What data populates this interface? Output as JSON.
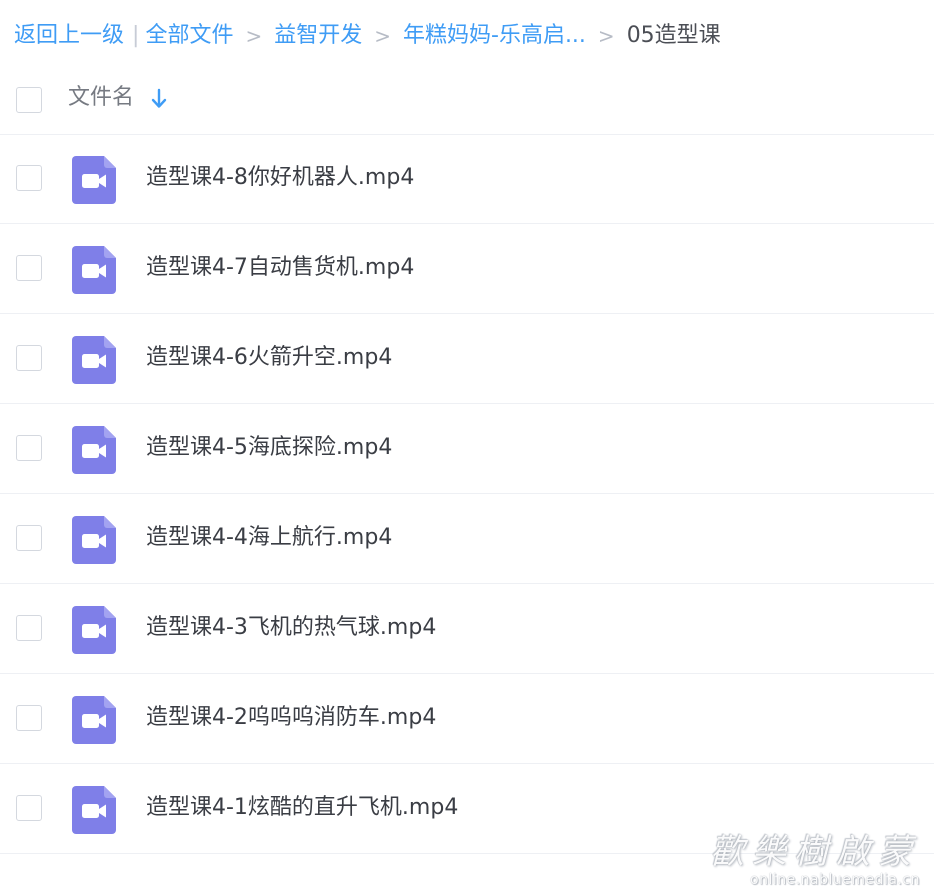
{
  "breadcrumb": {
    "back": "返回上一级",
    "items": [
      "全部文件",
      "益智开发",
      "年糕妈妈-乐高启..."
    ],
    "current": "05造型课",
    "separator": ">"
  },
  "list_header": {
    "column_label": "文件名"
  },
  "files": [
    {
      "name": "造型课4-8你好机器人.mp4"
    },
    {
      "name": "造型课4-7自动售货机.mp4"
    },
    {
      "name": "造型课4-6火箭升空.mp4"
    },
    {
      "name": "造型课4-5海底探险.mp4"
    },
    {
      "name": "造型课4-4海上航行.mp4"
    },
    {
      "name": "造型课4-3飞机的热气球.mp4"
    },
    {
      "name": "造型课4-2呜呜呜消防车.mp4"
    },
    {
      "name": "造型课4-1炫酷的直升飞机.mp4"
    }
  ],
  "watermark": {
    "title": "歡樂樹啟蒙",
    "url": "online.nabluemedia.cn"
  },
  "colors": {
    "link": "#3f9cf5",
    "video_icon": "#7f7fe8",
    "text": "#3a3d44"
  },
  "icons": {
    "file_type": "video-file-icon",
    "sort": "arrow-down-icon"
  }
}
